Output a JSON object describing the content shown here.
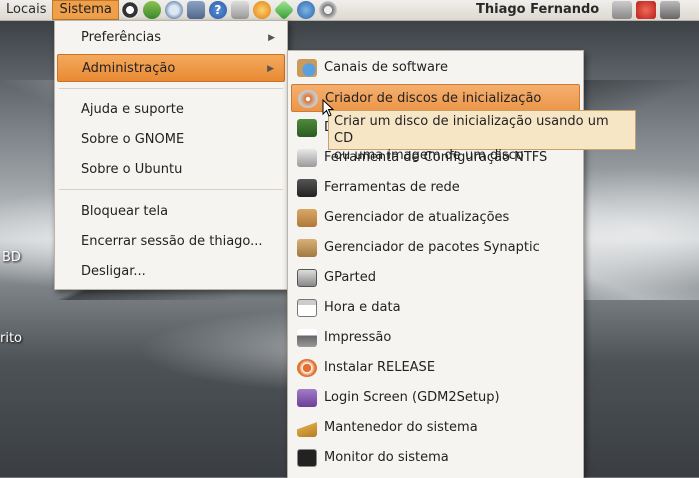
{
  "panel": {
    "menus": [
      "Locais",
      "Sistema"
    ],
    "user_name": "Thiago Fernando",
    "launcher_icons": [
      "accessibility-icon",
      "pidgin-icon",
      "browser-icon",
      "file-manager-icon",
      "help-icon",
      "screenshot-icon",
      "media-icon",
      "gem-icon",
      "network-icon",
      "speaker-icon"
    ],
    "tray_icons": [
      "network-manager-icon",
      "power-icon",
      "lock-icon"
    ]
  },
  "sistema_menu": {
    "items": [
      {
        "label": "Preferências",
        "submenu": true
      },
      {
        "label": "Administração",
        "submenu": true,
        "highlighted": true
      },
      {
        "label": "Ajuda e suporte"
      },
      {
        "label": "Sobre o GNOME"
      },
      {
        "label": "Sobre o Ubuntu"
      },
      {
        "label": "Bloquear tela"
      },
      {
        "label": "Encerrar sessão de thiago..."
      },
      {
        "label": "Desligar..."
      }
    ]
  },
  "admin_menu": {
    "items": [
      {
        "label": "Canais de software",
        "icon": "software-channels-icon"
      },
      {
        "label": "Criador de discos de inicialização",
        "icon": "startup-disk-creator-icon",
        "highlighted": true
      },
      {
        "label": "D",
        "icon": "drivers-icon"
      },
      {
        "label": "Ferramenta de Configuração NTFS",
        "icon": "ntfs-config-icon"
      },
      {
        "label": "Ferramentas de rede",
        "icon": "network-tools-icon"
      },
      {
        "label": "Gerenciador de atualizações",
        "icon": "update-manager-icon"
      },
      {
        "label": "Gerenciador de pacotes Synaptic",
        "icon": "synaptic-icon"
      },
      {
        "label": "GParted",
        "icon": "gparted-icon"
      },
      {
        "label": "Hora e data",
        "icon": "calendar-icon"
      },
      {
        "label": "Impressão",
        "icon": "printer-icon"
      },
      {
        "label": "Instalar RELEASE",
        "icon": "installer-icon"
      },
      {
        "label": "Login Screen (GDM2Setup)",
        "icon": "login-screen-icon"
      },
      {
        "label": "Mantenedor do sistema",
        "icon": "broom-icon"
      },
      {
        "label": "Monitor do sistema",
        "icon": "system-monitor-icon"
      }
    ]
  },
  "tooltip": {
    "line1": "Criar um disco de inicialização usando um CD",
    "line2": "ou uma imagem de um disco"
  },
  "desktop": {
    "labels": [
      "BD",
      "rito"
    ]
  },
  "colors": {
    "highlight": "#ec9548",
    "panel": "#e8e5df",
    "tooltip_bg": "#f7e6c6"
  }
}
